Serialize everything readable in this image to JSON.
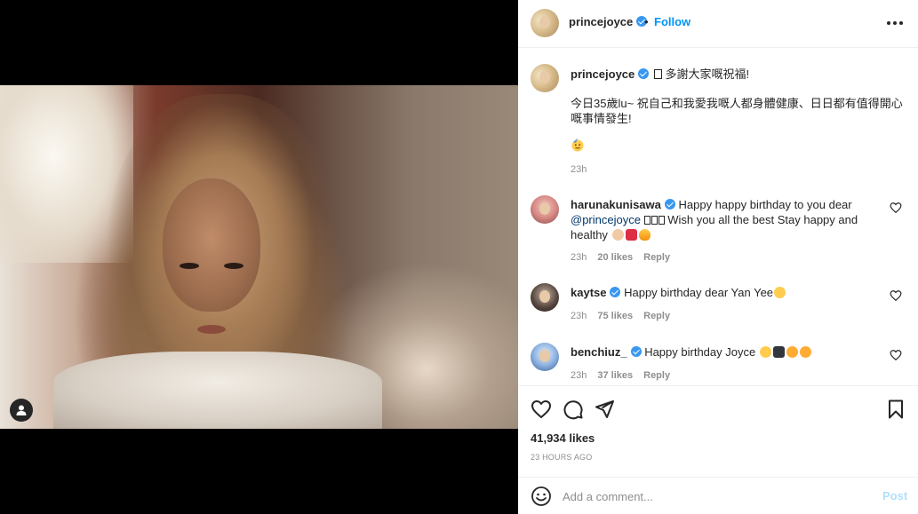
{
  "post": {
    "username": "princejoyce",
    "follow_label": "Follow",
    "separator": "•",
    "more_label": "More options"
  },
  "caption": {
    "username": "princejoyce",
    "line1": " 多謝大家嘅祝福!",
    "line2": "今日35歲lu~ 祝自己和我愛我嘅人都身體健康、日日都有值得開心嘅事情發生!",
    "time": "23h"
  },
  "comments": [
    {
      "username": "harunakunisawa",
      "text_a": " Happy happy birthday to you dear ",
      "mention": "@princejoyce",
      "text_b": " Wish you all the best  Stay happy and healthy ",
      "time": "23h",
      "likes": "20 likes",
      "reply": "Reply"
    },
    {
      "username": "kaytse",
      "text_a": " Happy birthday dear Yan Yee",
      "time": "23h",
      "likes": "75 likes",
      "reply": "Reply"
    },
    {
      "username": "benchiuz_",
      "text_a": " Happy birthday Joyce ",
      "time": "23h",
      "likes": "37 likes",
      "reply": "Reply"
    }
  ],
  "stats": {
    "likes": "41,934 likes",
    "ago": "23 HOURS AGO"
  },
  "add_comment": {
    "placeholder": "Add a comment...",
    "post_label": "Post"
  },
  "icons": {
    "like": "heart-icon",
    "comment": "comment-icon",
    "share": "share-icon",
    "save": "bookmark-icon",
    "emoji": "emoji-icon",
    "tag": "user-tag-icon"
  },
  "colors": {
    "accent": "#0095f6",
    "verified": "#3897f0",
    "text": "#262626",
    "muted": "#8e8e8e",
    "post_disabled": "#b2dffc"
  }
}
